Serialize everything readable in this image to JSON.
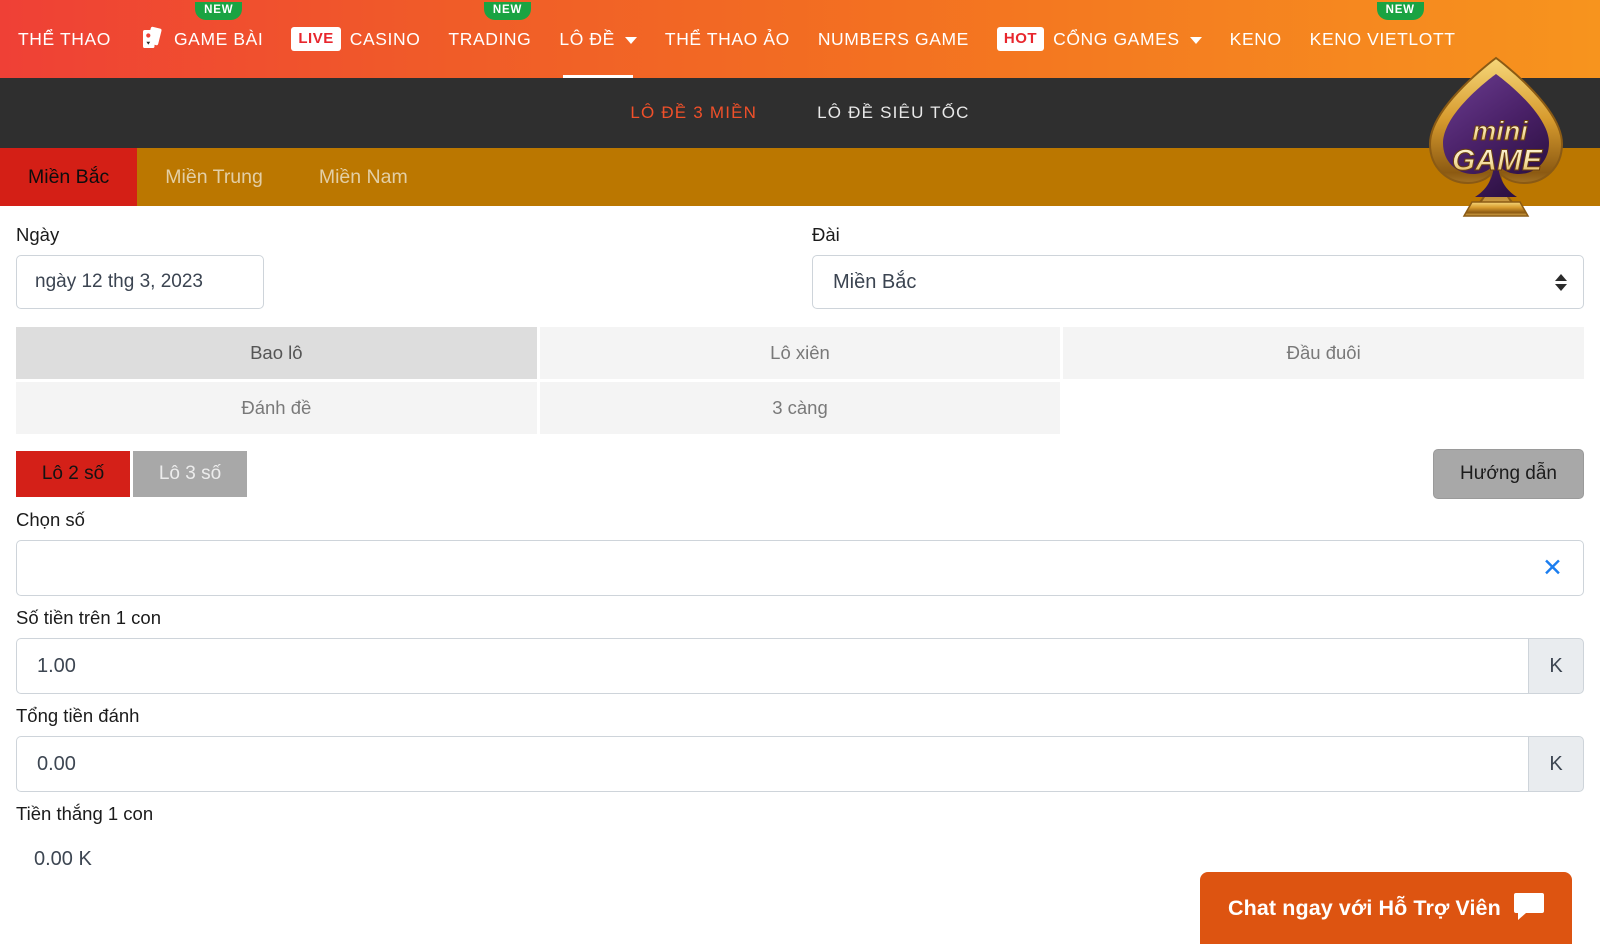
{
  "topnav": {
    "items": [
      {
        "label": "THỂ THAO",
        "badge": null,
        "tag": null,
        "icon": null,
        "active": false
      },
      {
        "label": "GAME BÀI",
        "badge": "NEW",
        "tag": null,
        "icon": "playing-cards-icon",
        "active": false
      },
      {
        "label": "CASINO",
        "badge": null,
        "tag": "LIVE",
        "icon": null,
        "active": false
      },
      {
        "label": "TRADING",
        "badge": "NEW",
        "tag": null,
        "icon": null,
        "active": false
      },
      {
        "label": "LÔ ĐỀ",
        "badge": null,
        "tag": null,
        "icon": "chevron-down-icon",
        "active": true
      },
      {
        "label": "THỂ THAO ẢO",
        "badge": null,
        "tag": null,
        "icon": null,
        "active": false
      },
      {
        "label": "NUMBERS GAME",
        "badge": null,
        "tag": null,
        "icon": null,
        "active": false
      },
      {
        "label": "CỔNG GAMES",
        "badge": null,
        "tag": "HOT",
        "icon": "chevron-down-icon",
        "active": false
      },
      {
        "label": "KENO",
        "badge": null,
        "tag": null,
        "icon": null,
        "active": false
      },
      {
        "label": "KENO VIETLOTT",
        "badge": "NEW",
        "tag": null,
        "icon": null,
        "active": false
      }
    ]
  },
  "subnav": {
    "items": [
      {
        "label": "LÔ ĐỀ 3 MIỀN",
        "active": true
      },
      {
        "label": "LÔ ĐỀ SIÊU TỐC",
        "active": false
      }
    ]
  },
  "region_tabs": {
    "items": [
      {
        "label": "Miền Bắc",
        "active": true
      },
      {
        "label": "Miền Trung",
        "active": false
      },
      {
        "label": "Miền Nam",
        "active": false
      }
    ]
  },
  "form": {
    "date": {
      "label": "Ngày",
      "value": "ngày 12 thg 3, 2023"
    },
    "station": {
      "label": "Đài",
      "value": "Miền Bắc"
    },
    "bet_types": [
      {
        "label": "Bao lô",
        "active": true
      },
      {
        "label": "Lô xiên",
        "active": false
      },
      {
        "label": "Đầu đuôi",
        "active": false
      },
      {
        "label": "Đánh đề",
        "active": false
      },
      {
        "label": "3 càng",
        "active": false
      }
    ],
    "sub_bets": [
      {
        "label": "Lô 2 số",
        "selected": true
      },
      {
        "label": "Lô 3 số",
        "selected": false
      }
    ],
    "guide_button": "Hướng dẫn",
    "chon_so": {
      "label": "Chọn số",
      "value": "",
      "clear_icon": "✕"
    },
    "amount_per": {
      "label": "Số tiền trên 1 con",
      "value": "1.00",
      "unit": "K"
    },
    "total_amount": {
      "label": "Tổng tiền đánh",
      "value": "0.00",
      "unit": "K"
    },
    "win_amount": {
      "label": "Tiền thắng 1 con",
      "value": "0.00 K"
    }
  },
  "minigame": {
    "line1": "mini",
    "line2": "GAME"
  },
  "chat": {
    "label": "Chat ngay với Hỗ Trợ Viên",
    "icon": "chat-bubble-icon"
  },
  "colors": {
    "nav_start": "#ef4036",
    "nav_end": "#f7941e",
    "subnav_bg": "#2f2f2f",
    "subnav_active": "#f0502a",
    "region_bg": "#bb7700",
    "region_active": "#d41f16",
    "bet_active": "#dddddd",
    "bet_inactive": "#f4f4f4",
    "badge_new": "#1aa342",
    "clear_blue": "#1b7ef0",
    "chat_bg": "#dd5411"
  }
}
